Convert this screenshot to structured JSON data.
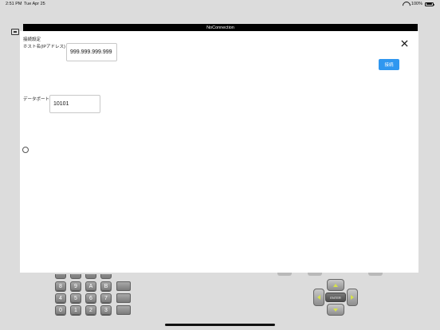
{
  "status_bar": {
    "time": "2:51 PM",
    "date": "Tue Apr 25",
    "battery": "100%"
  },
  "title_bar": {
    "title": "NoConnection"
  },
  "connection_settings": {
    "section_title": "接続設定",
    "host_label": "ホスト名(IPアドレス)",
    "host_value": "999.999.999.999",
    "connect_label": "接続",
    "port_label": "データポート",
    "port_value": "10101"
  },
  "icons": {
    "close": "close-icon",
    "wifi": "wifi-icon",
    "battery": "battery-icon",
    "app": "app-icon"
  },
  "keypad": {
    "row1": [
      "8",
      "9",
      "A",
      "B"
    ],
    "row2": [
      "4",
      "5",
      "6",
      "7"
    ],
    "row3": [
      "0",
      "1",
      "2",
      "3"
    ]
  },
  "dpad": {
    "enter_label": "ENTER"
  },
  "colors": {
    "accent": "#2f97f0",
    "title_bar_bg": "#000000",
    "arrow": "#d6e24a"
  }
}
